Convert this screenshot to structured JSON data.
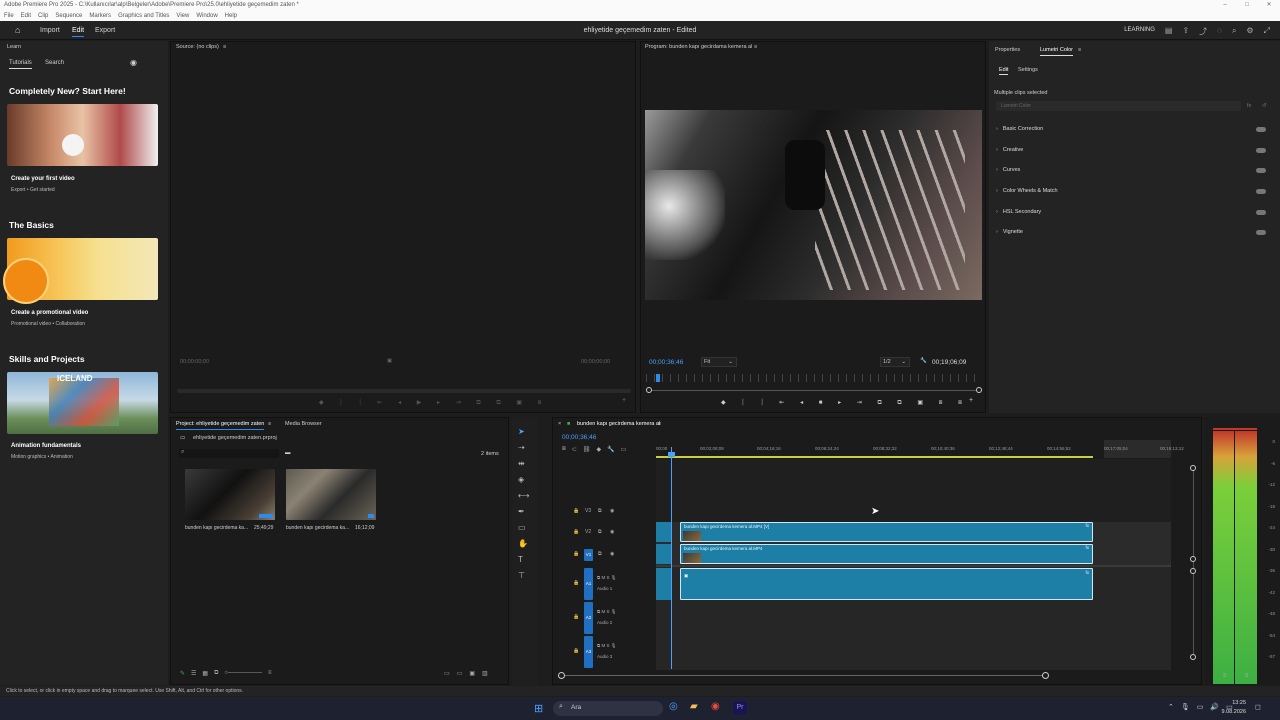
{
  "window": {
    "title": "Adobe Premiere Pro 2025 - C:\\Kullanıcılar\\alp\\Belgeler\\Adobe\\Premiere Pro\\25.0\\ehliyetide geçemedim zaten *"
  },
  "menu": [
    "File",
    "Edit",
    "Clip",
    "Sequence",
    "Markers",
    "Graphics and Titles",
    "View",
    "Window",
    "Help"
  ],
  "nav": {
    "import": "Import",
    "edit": "Edit",
    "export": "Export",
    "doc_title": "ehliyetide geçemedim zaten - Edited",
    "learning": "LEARNING"
  },
  "learn": {
    "panel_title": "Learn",
    "tabs": [
      "Tutorials",
      "Search"
    ],
    "sections": [
      {
        "title": "Completely New? Start Here!",
        "card_title": "Create your first video",
        "card_sub": "Export • Get started"
      },
      {
        "title": "The Basics",
        "card_title": "Create a promotional video",
        "card_sub": "Promotional video • Collaboration"
      },
      {
        "title": "Skills and Projects",
        "card_title": "Animation fundamentals",
        "card_sub": "Motion graphics • Animation",
        "image_text": "ICELAND"
      }
    ]
  },
  "source": {
    "title": "Source: (no clips)",
    "tc_left": "00;00;00;00",
    "tc_right": "00;00;00;00"
  },
  "program": {
    "title": "Program: bunden kapı gecirdama kemera al",
    "timecode": "00;00;36;46",
    "fit": "Fit",
    "res": "1/2",
    "duration": "00;19;06;09"
  },
  "lumetri": {
    "tabs": [
      "Properties",
      "Lumetri Color"
    ],
    "subtabs": [
      "Edit",
      "Settings"
    ],
    "selection": "Multiple clips selected",
    "dropdown": "Lumetri Color",
    "sections": [
      "Basic Correction",
      "Creative",
      "Curves",
      "Color Wheels & Match",
      "HSL Secondary",
      "Vignette"
    ]
  },
  "project": {
    "tabs": [
      "Project: ehliyetide geçemedim zaten",
      "Media Browser"
    ],
    "file": "ehliyetide geçemedim zaten.prproj",
    "items_count": "2 items",
    "clips": [
      {
        "name": "bunden kapı gecirdema ka...",
        "duration": "25;49;29"
      },
      {
        "name": "bunden kapı gecirdema ka...",
        "duration": "16;12;09"
      }
    ]
  },
  "timeline": {
    "title": "bunden kapı gecirdema kemera al",
    "timecode": "00;00;36;46",
    "ruler": [
      "00;00",
      "00;02;08;08",
      "00;04;16;16",
      "00;06;24;24",
      "00;08;32;32",
      "00;10;40;36",
      "00;12;48;44",
      "00;14;56;52",
      "00;17;05;04",
      "00;19;13;12"
    ],
    "tracks": {
      "v3": "V3",
      "v2": "V2",
      "v1": "V1",
      "a1": "A1",
      "a2": "A2",
      "a3": "A3",
      "audio1": "Audio 1",
      "audio2": "Audio 2",
      "audio3": "Audio 3"
    },
    "clips": {
      "v2": "bunden kapı gecirdema kemera al.MP4 [V]",
      "v1": "bunden kapı gecirdema kemera al.MP4"
    }
  },
  "meter": {
    "scale": [
      "0",
      "-6",
      "-12",
      "-18",
      "-24",
      "-30",
      "-36",
      "-42",
      "-48",
      "-54",
      "-57"
    ],
    "solo": [
      "S",
      "S"
    ]
  },
  "status": "Click to select, or click in empty space and drag to marquee select. Use Shift, Alt, and Ctrl for other options.",
  "taskbar": {
    "search": "Ara",
    "time": "13:25",
    "date": "9.08.2026"
  },
  "colors": {
    "accent": "#2d8ceb",
    "clip": "#1e7fa6",
    "meter_green": "#3cb043",
    "meter_red": "#c0392b"
  }
}
